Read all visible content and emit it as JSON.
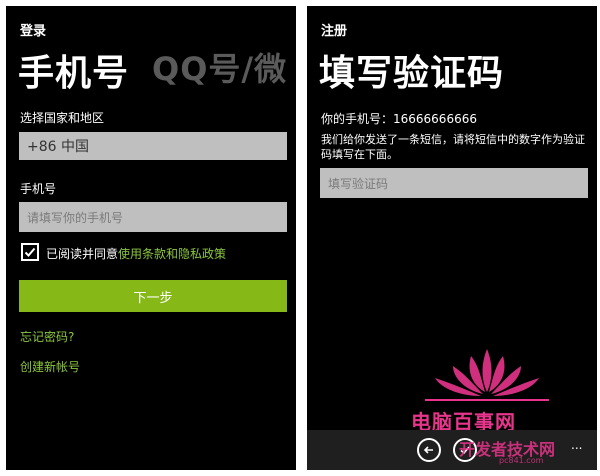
{
  "left": {
    "header_small": "登录",
    "title_main": "手机号",
    "title_next_pivot": "QQ号/微",
    "country_label": "选择国家和地区",
    "country_value": "+86 中国",
    "phone_label": "手机号",
    "phone_placeholder": "请填写你的手机号",
    "agree_prefix": "已阅读并同意",
    "agree_link": "使用条款和隐私政策",
    "next_button": "下一步",
    "forgot_link": "忘记密码?",
    "create_link": "创建新帐号"
  },
  "right": {
    "header_small": "注册",
    "title_main": "填写验证码",
    "phone_line": "你的手机号：16666666666",
    "info_line1": "我们给你发送了一条短信，请将短信中的数字作为验证",
    "info_line2": "码填写在下面。",
    "code_placeholder": "填写验证码",
    "appbar_more": "...",
    "appbar_back_icon": "arrow-left-icon",
    "appbar_confirm_icon": "check-icon"
  },
  "watermark": {
    "brand_text": "电脑百事网",
    "sub_text": "开发者技术网",
    "url_text": "pc841.com"
  },
  "colors": {
    "accent_green": "#8cc63f",
    "button_green": "#86b817",
    "input_gray": "#bfbfbf",
    "watermark_pink": "#e6358a"
  }
}
